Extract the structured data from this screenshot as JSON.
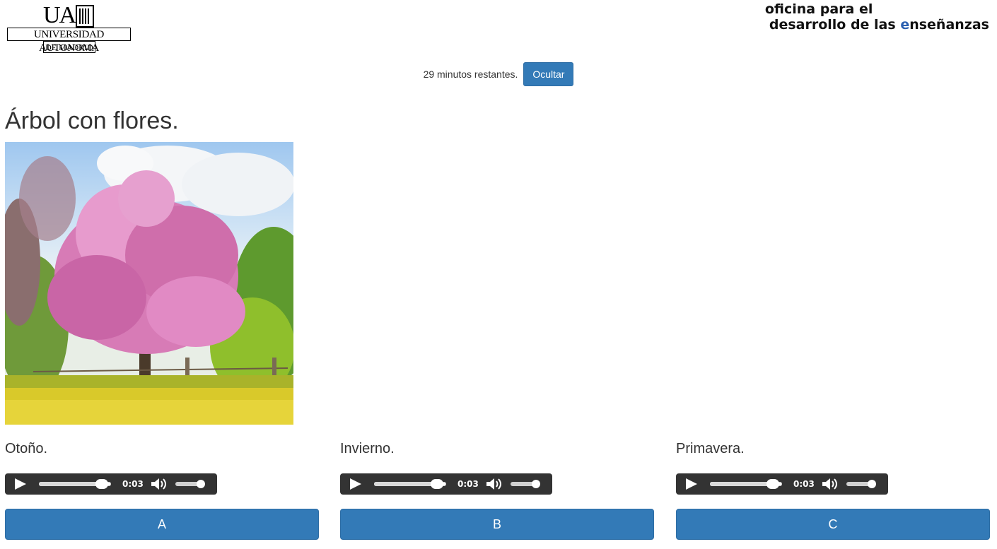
{
  "header": {
    "uam_logo": {
      "mark": "UA",
      "name": "UNIVERSIDAD AUTONOMA",
      "city": "DE MADRID"
    },
    "ode_logo": {
      "line1": "oficina para el",
      "line2_start": "desarrollo de las ",
      "line2_e": "e",
      "line2_end": "nseñanzas"
    }
  },
  "timer": {
    "text": "29 minutos restantes.",
    "hide_label": "Ocultar"
  },
  "question": {
    "title": "Árbol con flores."
  },
  "options": [
    {
      "label": "Otoño.",
      "time": "0:03",
      "progress": 0.88,
      "volume": 0.9,
      "button": "A"
    },
    {
      "label": "Invierno.",
      "time": "0:03",
      "progress": 0.88,
      "volume": 0.9,
      "button": "B"
    },
    {
      "label": "Primavera.",
      "time": "0:03",
      "progress": 0.88,
      "volume": 0.9,
      "button": "C"
    }
  ],
  "colors": {
    "primary": "#337ab7",
    "player_bg": "#333333",
    "ode_blue": "#2a5fb0"
  },
  "icons": [
    "play-icon",
    "volume-icon"
  ]
}
